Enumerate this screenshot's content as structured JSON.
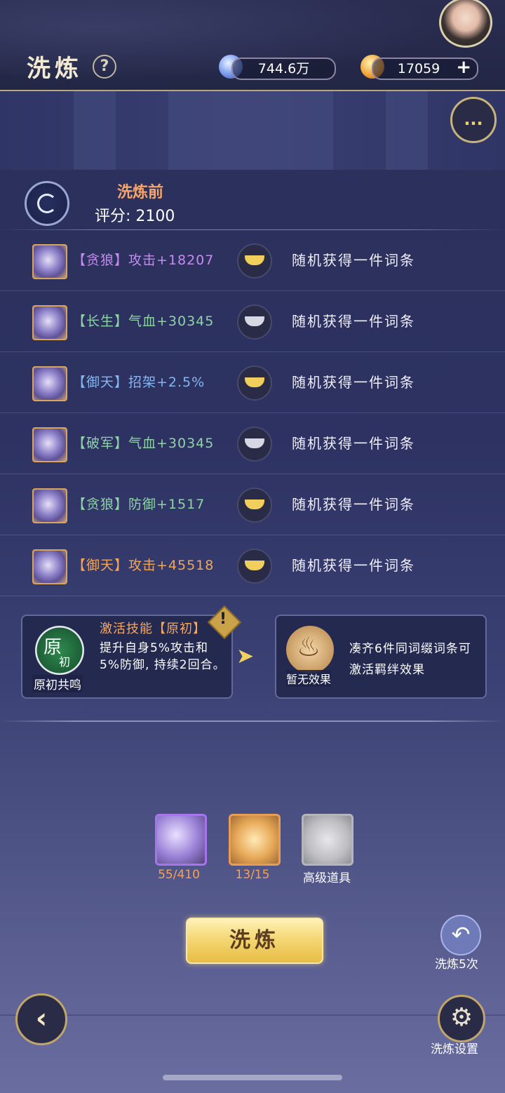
{
  "header": {
    "title": "洗炼",
    "help_label": "?",
    "currency1": "744.6万",
    "currency2": "17059",
    "plus_label": "+"
  },
  "chat_label": "...",
  "score": {
    "before_label": "洗炼前",
    "score_text": "评分:  2100"
  },
  "rows": [
    {
      "attr": "【贪狼】攻击+18207",
      "desc": "随机获得一件词条"
    },
    {
      "attr": "【长生】气血+30345",
      "desc": "随机获得一件词条"
    },
    {
      "attr": "【御天】招架+2.5%",
      "desc": "随机获得一件词条"
    },
    {
      "attr": "【破军】气血+30345",
      "desc": "随机获得一件词条"
    },
    {
      "attr": "【贪狼】防御+1517",
      "desc": "随机获得一件词条"
    },
    {
      "attr": "【御天】攻击+45518",
      "desc": "随机获得一件词条"
    }
  ],
  "skill": {
    "icon_big": "原",
    "icon_small": "初",
    "icon_label": "原初共鸣",
    "title": "激活技能【原初】",
    "desc": "提升自身5%攻击和5%防御, 持续2回合。",
    "warn_mark": "!"
  },
  "bond": {
    "label": "暂无效果",
    "desc": "凑齐6件同词缀词条可激活羁绊效果"
  },
  "items": [
    {
      "count": "55/410"
    },
    {
      "count": "13/15"
    },
    {
      "count": "高级道具"
    }
  ],
  "main_button": "洗炼",
  "undo_label": "洗炼5次",
  "settings_label": "洗炼设置"
}
